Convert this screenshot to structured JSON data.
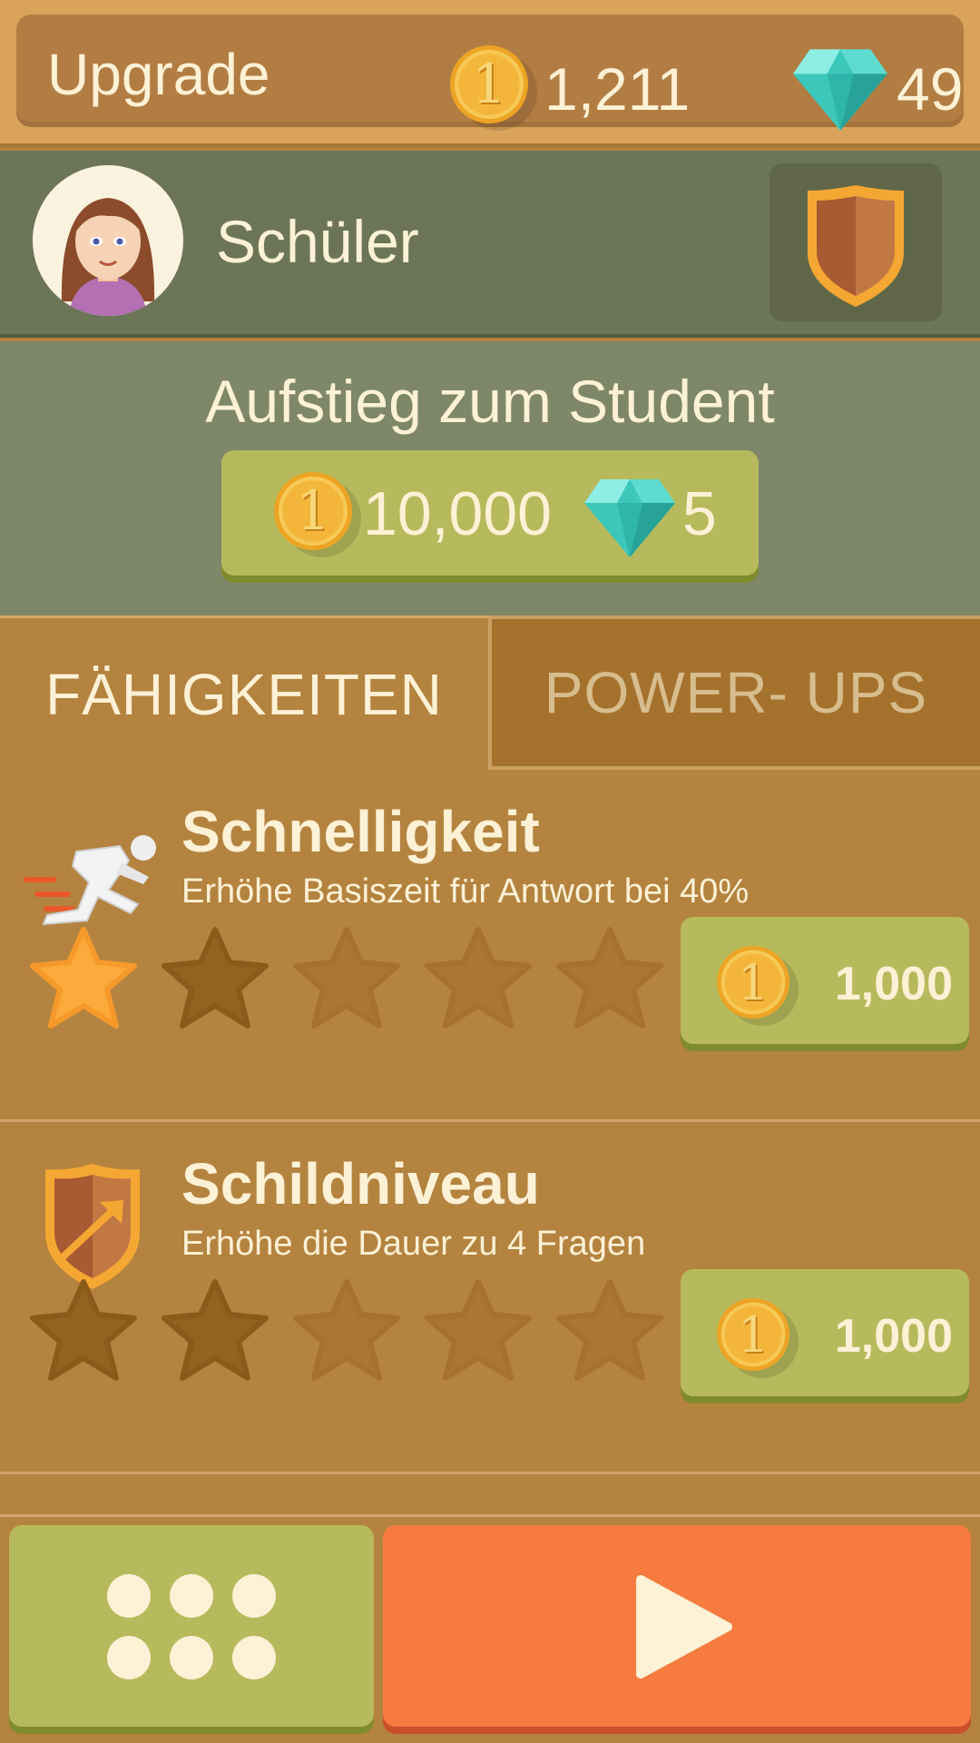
{
  "header": {
    "title": "Upgrade",
    "coins": "1,211",
    "gems": "49"
  },
  "profile": {
    "rank_name": "Schüler"
  },
  "rank_up": {
    "title": "Aufstieg zum Student",
    "cost_coins": "10,000",
    "cost_gems": "5"
  },
  "tabs": [
    {
      "label": "FÄHIGKEITEN",
      "active": true
    },
    {
      "label": "POWER- UPS",
      "active": false
    }
  ],
  "skills": [
    {
      "title": "Schnelligkeit",
      "description": "Erhöhe Basiszeit für Antwort bei 40%",
      "icon": "runner-icon",
      "level": 1,
      "max_level": 5,
      "price": "1,000"
    },
    {
      "title": "Schildniveau",
      "description": "Erhöhe die Dauer zu 4 Fragen",
      "icon": "shield-upgrade-icon",
      "level": 0,
      "max_level": 5,
      "price": "1,000"
    }
  ],
  "bottom_nav": {
    "menu_icon": "grid-dots-icon",
    "play_icon": "play-icon"
  },
  "colors": {
    "background": "#b4833f",
    "green_button": "#b6ba5c",
    "play_button": "#f77b40",
    "profile_bar": "#6c7557",
    "star_earned": "#fbaa3b"
  }
}
